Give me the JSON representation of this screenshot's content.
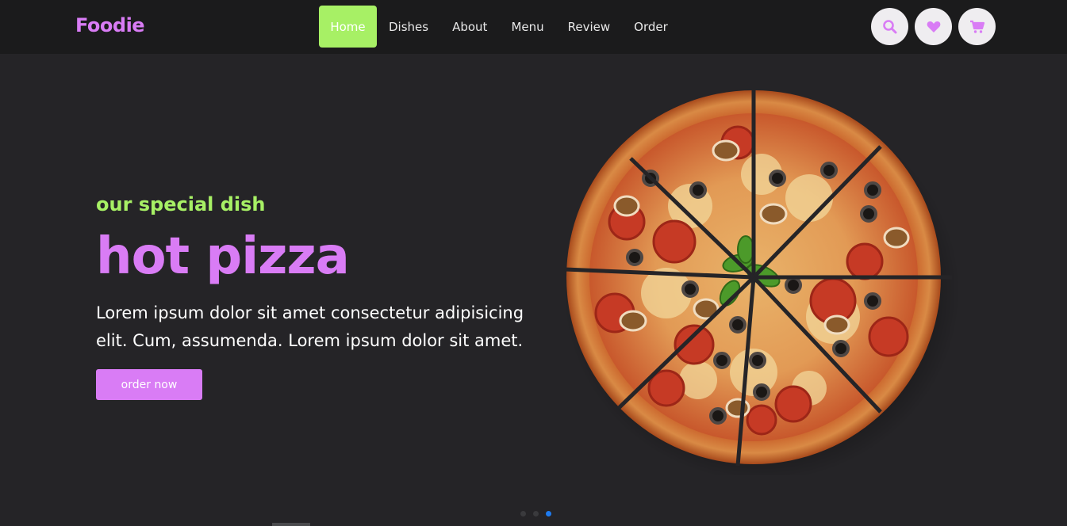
{
  "brand": {
    "name": "Foodie",
    "color": "#d97cf5"
  },
  "nav": {
    "items": [
      {
        "label": "Home",
        "active": true
      },
      {
        "label": "Dishes",
        "active": false
      },
      {
        "label": "About",
        "active": false
      },
      {
        "label": "Menu",
        "active": false
      },
      {
        "label": "Review",
        "active": false
      },
      {
        "label": "Order",
        "active": false
      }
    ],
    "active_color": "#a7f065"
  },
  "nav_icons": [
    "search-icon",
    "heart-icon",
    "cart-icon"
  ],
  "hero": {
    "subtitle": "our special dish",
    "title": "hot pizza",
    "description": "Lorem ipsum dolor sit amet consectetur adipisicing elit. Cum, assumenda. Lorem ipsum dolor sit amet.",
    "button_label": "order now",
    "image": "pizza"
  },
  "slider": {
    "slides": 3,
    "active_index": 2,
    "active_color": "#1e7bf0"
  },
  "colors": {
    "background": "#252427",
    "accent": "#d97cf5",
    "highlight": "#a7f065"
  }
}
